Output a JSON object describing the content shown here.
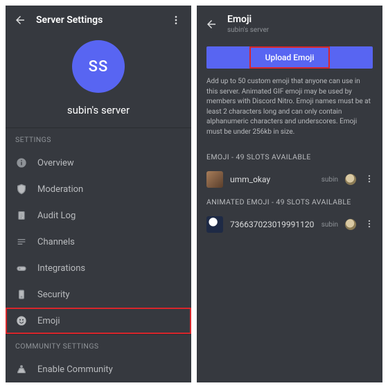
{
  "left": {
    "title": "Server Settings",
    "avatar_initials": "SS",
    "server_name": "subin's server",
    "section_settings": "SETTINGS",
    "items": [
      {
        "label": "Overview"
      },
      {
        "label": "Moderation"
      },
      {
        "label": "Audit Log"
      },
      {
        "label": "Channels"
      },
      {
        "label": "Integrations"
      },
      {
        "label": "Security"
      },
      {
        "label": "Emoji"
      }
    ],
    "section_community": "COMMUNITY SETTINGS",
    "community_item": "Enable Community"
  },
  "right": {
    "title": "Emoji",
    "subtitle": "subin's server",
    "upload_label": "Upload Emoji",
    "description": "Add up to 50 custom emoji that anyone can use in this server. Animated GIF emoji may be used by members with Discord Nitro. Emoji names must be at least 2 characters long and can only contain alphanumeric characters and underscores. Emoji must be under 256kb in size.",
    "static_header": "EMOJI - 49 SLOTS AVAILABLE",
    "animated_header": "ANIMATED EMOJI - 49 SLOTS AVAILABLE",
    "emoji_static": {
      "name": "umm_okay",
      "uploader": "subin"
    },
    "emoji_animated": {
      "name": "736637023019991120",
      "uploader": "subin"
    }
  }
}
